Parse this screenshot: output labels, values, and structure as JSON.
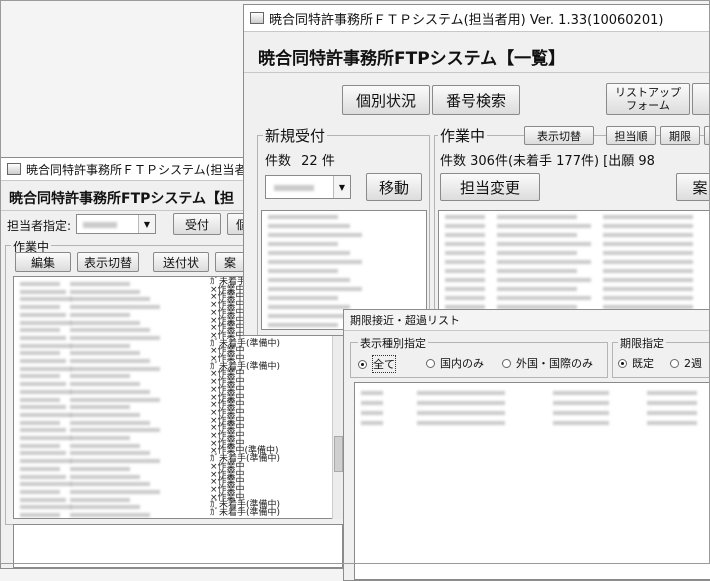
{
  "back_window": {
    "title": "暁合同特許事務所ＦＴＰシステム(担当者用)  Ver. 1.",
    "heading": "暁合同特許事務所FTPシステム【担",
    "assignee_label": "担当者指定:",
    "receive_btn": "受付",
    "individual_btn": "個",
    "group_label": "作業中",
    "edit_btn": "編集",
    "toggle_btn": "表示切替",
    "send_btn": "送付状",
    "case_btn": "案",
    "statuses": [
      "ｶﾞ未着手(準備中)",
      "×作業中",
      "×作業中",
      "×作業中",
      "×作業中",
      "×作業中",
      "×作業中",
      "×作業中",
      "ｶﾞ未着手(準備中)",
      "×作業中",
      "×作業中",
      "ｶﾞ未着手(準備中)",
      "×作業中",
      "×作業中",
      "×作業中",
      "×作業中",
      "×作業中",
      "×作業中",
      "×作業中",
      "×作業中",
      "×作業中",
      "×作業中",
      "×作業中(準備中)",
      "ｶﾞ未着手(準備中)",
      "×作業中",
      "×作業中",
      "×作業中",
      "×作業中",
      "×作業中",
      "ｶﾞ未着手(準備中)",
      "ｶﾞ未着手(準備中)"
    ]
  },
  "main_window": {
    "title": "暁合同特許事務所ＦＴＰシステム(担当者用)   Ver. 1.33(10060201)",
    "heading": "暁合同特許事務所FTPシステム【一覧】",
    "individual_status_btn": "個別状況",
    "number_search_btn": "番号検索",
    "list_up_btn_line1": "リストアップ",
    "list_up_btn_line2": "フォーム",
    "new_receive": {
      "label": "新規受付",
      "count_label": "件数",
      "count": "22",
      "count_unit": "件",
      "move_btn": "移動"
    },
    "in_progress": {
      "label": "作業中",
      "toggle_btn": "表示切替",
      "sort_assignee_btn": "担当順",
      "sort_deadline_btn": "期限",
      "count_text": "件数 306件(未着手 177件) [出願 98",
      "change_assignee_btn": "担当変更",
      "right_btn": "案"
    }
  },
  "deadline_window": {
    "title": "期限接近・超過リスト",
    "type_group": "表示種別指定",
    "radios": [
      {
        "label": "全て",
        "checked": true
      },
      {
        "label": "国内のみ",
        "checked": false
      },
      {
        "label": "外国・国際のみ",
        "checked": false
      }
    ],
    "deadline_group": "期限指定",
    "deadline_radios": [
      {
        "label": "既定",
        "checked": true
      },
      {
        "label": "2週",
        "checked": false
      }
    ]
  }
}
